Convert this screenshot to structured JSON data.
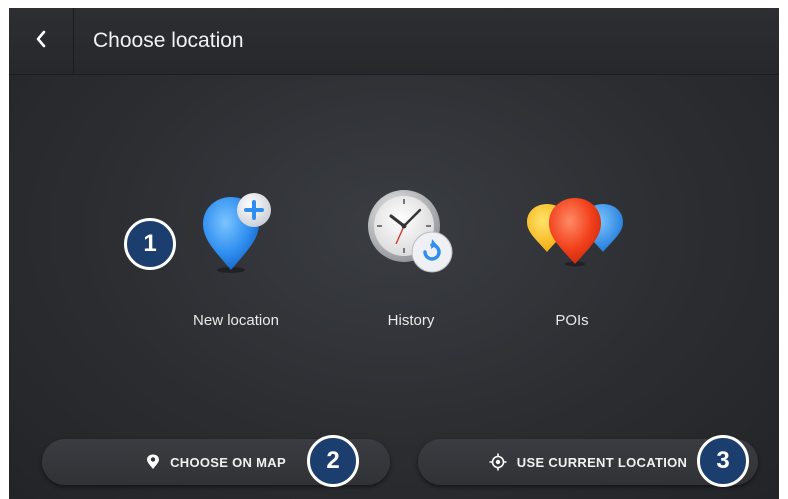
{
  "header": {
    "title": "Choose location",
    "back_icon": "chevron-left-icon"
  },
  "options": [
    {
      "label": "New location",
      "icon": "new-location-pin-plus-icon"
    },
    {
      "label": "History",
      "icon": "history-clock-icon"
    },
    {
      "label": "POIs",
      "icon": "poi-pins-icon"
    }
  ],
  "bottom": {
    "choose_on_map": "CHOOSE ON MAP",
    "use_current_location": "USE CURRENT LOCATION"
  },
  "callouts": [
    "1",
    "2",
    "3"
  ],
  "colors": {
    "background": "#2b2d31",
    "accent_blue": "#2f8ff0",
    "callout_fill": "#1c3e6e",
    "text": "#f2f2f2"
  }
}
